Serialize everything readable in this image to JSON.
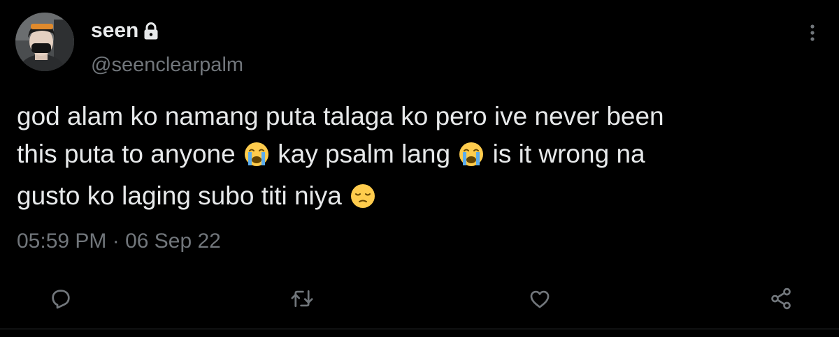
{
  "author": {
    "display_name": "seen",
    "handle": "@seenclearpalm",
    "protected": true
  },
  "tweet": {
    "lines": [
      {
        "segments": [
          {
            "type": "text",
            "value": "god alam ko namang puta talaga ko pero ive never been"
          }
        ]
      },
      {
        "segments": [
          {
            "type": "text",
            "value": "this puta to anyone "
          },
          {
            "type": "emoji",
            "value": "loudly-crying-face"
          },
          {
            "type": "text",
            "value": " kay psalm lang "
          },
          {
            "type": "emoji",
            "value": "loudly-crying-face"
          },
          {
            "type": "text",
            "value": " is it wrong na"
          }
        ]
      },
      {
        "segments": [
          {
            "type": "text",
            "value": "gusto ko laging subo titi niya "
          },
          {
            "type": "emoji",
            "value": "pensive-face"
          }
        ]
      }
    ],
    "timestamp": "05:59 PM · 06 Sep 22"
  },
  "actions": {
    "reply": "reply-icon",
    "retweet": "retweet-icon",
    "like": "heart-icon",
    "share": "share-icon"
  },
  "colors": {
    "background": "#000000",
    "text_primary": "#e7e9ea",
    "text_secondary": "#71767b",
    "divider": "#2f3336"
  }
}
